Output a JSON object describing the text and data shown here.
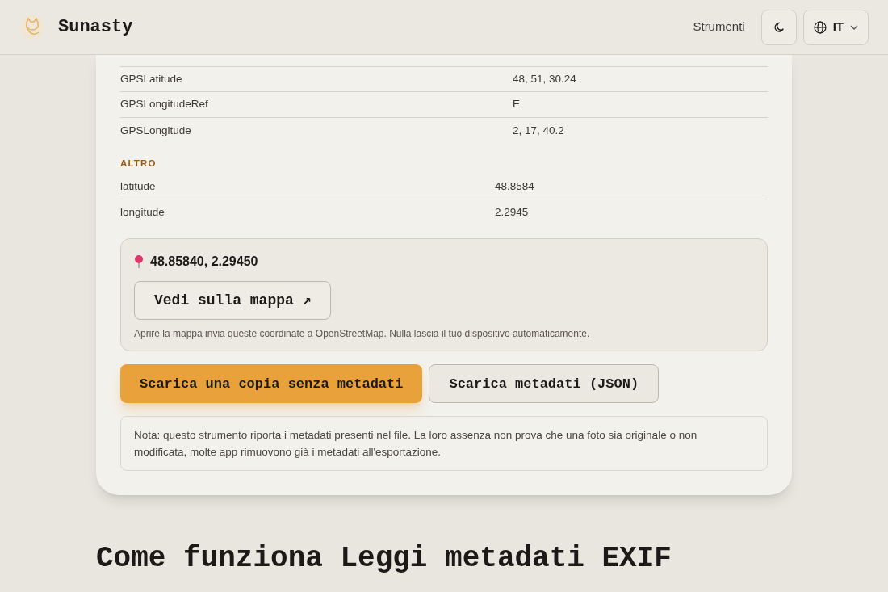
{
  "header": {
    "brand": "Sunasty",
    "nav_link": "Strumenti",
    "language": "IT"
  },
  "sections": [
    {
      "rows": [
        {
          "key": "GPSLatitude",
          "value": "48, 51, 30.24"
        },
        {
          "key": "GPSLongitudeRef",
          "value": "E"
        },
        {
          "key": "GPSLongitude",
          "value": "2, 17, 40.2"
        }
      ]
    },
    {
      "title": "ALTRO",
      "rows": [
        {
          "key": "latitude",
          "value": "48.8584"
        },
        {
          "key": "longitude",
          "value": "2.2945"
        }
      ]
    }
  ],
  "location": {
    "coordinates": "48.85840, 2.29450",
    "map_button": "Vedi sulla mappa ↗",
    "privacy_note": "Aprire la mappa invia queste coordinate a OpenStreetMap. Nulla lascia il tuo dispositivo automaticamente."
  },
  "actions": [
    {
      "label": "Scarica una copia senza metadati",
      "kind": "primary"
    },
    {
      "label": "Scarica metadati (JSON)",
      "kind": "secondary"
    }
  ],
  "note": "Nota: questo strumento riporta i metadati presenti nel file. La loro assenza non prova che una foto sia originale o non modificata, molte app rimuovono già i metadati all'esportazione.",
  "section_heading": "Come funziona Leggi metadati EXIF"
}
